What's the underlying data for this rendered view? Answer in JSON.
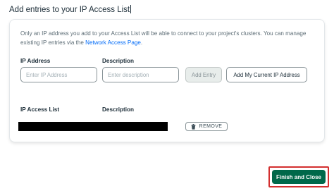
{
  "dialog": {
    "title": "Add entries to your IP Access List"
  },
  "card": {
    "intro_text": "Only an IP address you add to your Access List will be able to connect to your project's clusters. You can manage existing IP entries via the ",
    "intro_link": "Network Access Page",
    "intro_end": ".",
    "ip_address_label": "IP Address",
    "description_label": "Description",
    "ip_address_placeholder": "Enter IP Address",
    "description_placeholder": "Enter description",
    "add_entry_label": "Add Entry",
    "add_current_ip_label": "Add My Current IP Address",
    "list_ip_header": "IP Access List",
    "list_description_header": "Description",
    "remove_label": "REMOVE"
  },
  "footer": {
    "finish_label": "Finish and Close"
  },
  "icons": {
    "remove": "trash-icon"
  },
  "colors": {
    "link": "#016bf8",
    "primary_button": "#00684a",
    "highlight_border": "#d32f2f"
  }
}
